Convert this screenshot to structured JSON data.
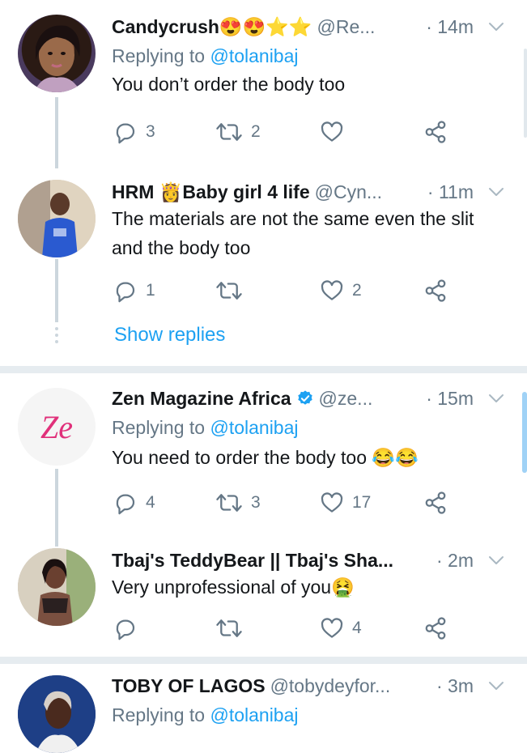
{
  "tweets": [
    {
      "name": "Candycrush😍😍⭐⭐",
      "handle": "@Re...",
      "time": "· 14m",
      "replying_prefix": "Replying to ",
      "replying_to": "@tolanibaj",
      "text": "You don’t order the body too",
      "reply_count": "3",
      "retweet_count": "2",
      "like_count": ""
    },
    {
      "name": "HRM 👸Baby girl 4 life",
      "handle": "@Cyn...",
      "time": "· 11m",
      "text": "The materials are not the same even the slit and the body too",
      "reply_count": "1",
      "retweet_count": "",
      "like_count": "2",
      "show_replies": "Show replies"
    },
    {
      "name": "Zen Magazine Africa",
      "handle": "@ze...",
      "time": "· 15m",
      "replying_prefix": "Replying to ",
      "replying_to": "@tolanibaj",
      "text": "You need to order the body too 😂😂",
      "reply_count": "4",
      "retweet_count": "3",
      "like_count": "17",
      "verified": true,
      "avatar_text": "Ze"
    },
    {
      "name": "Tbaj's TeddyBear || Tbaj's Sha...",
      "handle": "",
      "time": "· 2m",
      "text": "Very unprofessional of you🤮",
      "reply_count": "",
      "retweet_count": "",
      "like_count": "4"
    },
    {
      "name": "TOBY OF LAGOS",
      "handle": "@tobydeyfor...",
      "time": "· 3m",
      "replying_prefix": "Replying to ",
      "replying_to": "@tolanibaj"
    }
  ],
  "colors": {
    "accent": "#1da1f2",
    "secondary_text": "#657786",
    "thread_line": "#ccd6dd",
    "verified": "#1da1f2"
  },
  "icons": [
    "reply-icon",
    "retweet-icon",
    "like-icon",
    "share-icon",
    "chevron-down-icon",
    "verified-badge-icon"
  ]
}
